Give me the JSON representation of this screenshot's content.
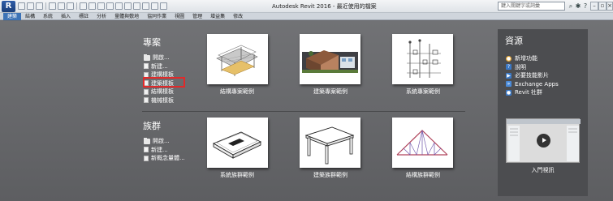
{
  "window": {
    "title": "Autodesk Revit 2016 -      最近使用的檔案",
    "search_placeholder": "鍵入關鍵字或詞彙",
    "app_logo": "R"
  },
  "ribbon": {
    "tabs": [
      "建築",
      "結構",
      "系統",
      "插入",
      "標註",
      "分析",
      "量體與敷地",
      "協同作業",
      "視圖",
      "管理",
      "增益集",
      "修改"
    ],
    "active_tab": 0
  },
  "projects": {
    "title": "專案",
    "links": [
      {
        "label": "開啟...",
        "icon": "folder-icon"
      },
      {
        "label": "新建...",
        "icon": "new-file-icon"
      },
      {
        "label": "建構樣板",
        "icon": "template-icon"
      },
      {
        "label": "建築樣板",
        "icon": "template-icon"
      },
      {
        "label": "結構樣板",
        "icon": "template-icon"
      },
      {
        "label": "機械樣板",
        "icon": "template-icon"
      }
    ],
    "samples": [
      {
        "label": "結構專案範例",
        "icon": "structural-project-thumbnail"
      },
      {
        "label": "建築專案範例",
        "icon": "architectural-project-thumbnail"
      },
      {
        "label": "系統專案範例",
        "icon": "systems-project-thumbnail"
      }
    ]
  },
  "families": {
    "title": "族群",
    "links": [
      {
        "label": "開啟...",
        "icon": "folder-icon"
      },
      {
        "label": "新建...",
        "icon": "new-file-icon"
      },
      {
        "label": "新概念量體...",
        "icon": "mass-icon"
      }
    ],
    "samples": [
      {
        "label": "系統族群範例",
        "icon": "system-family-thumbnail"
      },
      {
        "label": "建築族群範例",
        "icon": "architectural-family-thumbnail"
      },
      {
        "label": "結構族群範例",
        "icon": "structural-family-thumbnail"
      }
    ]
  },
  "resources": {
    "title": "資源",
    "items": [
      {
        "label": "新增功能",
        "icon": "whats-new-icon",
        "color": "#e8a630"
      },
      {
        "label": "說明",
        "icon": "help-icon",
        "color": "#3b78c4"
      },
      {
        "label": "必要技能影片",
        "icon": "video-icon",
        "color": "#3b78c4"
      },
      {
        "label": "Exchange Apps",
        "icon": "exchange-apps-icon",
        "color": "#4a8ad8"
      },
      {
        "label": "Revit 社群",
        "icon": "community-icon",
        "color": "#3b78c4"
      }
    ],
    "video_label": "入門視訊"
  },
  "colors": {
    "background": "#6a6b6e",
    "panel": "#4c4d50",
    "highlight_box": "#e12a2a",
    "active_tab": "#3d73b6"
  }
}
